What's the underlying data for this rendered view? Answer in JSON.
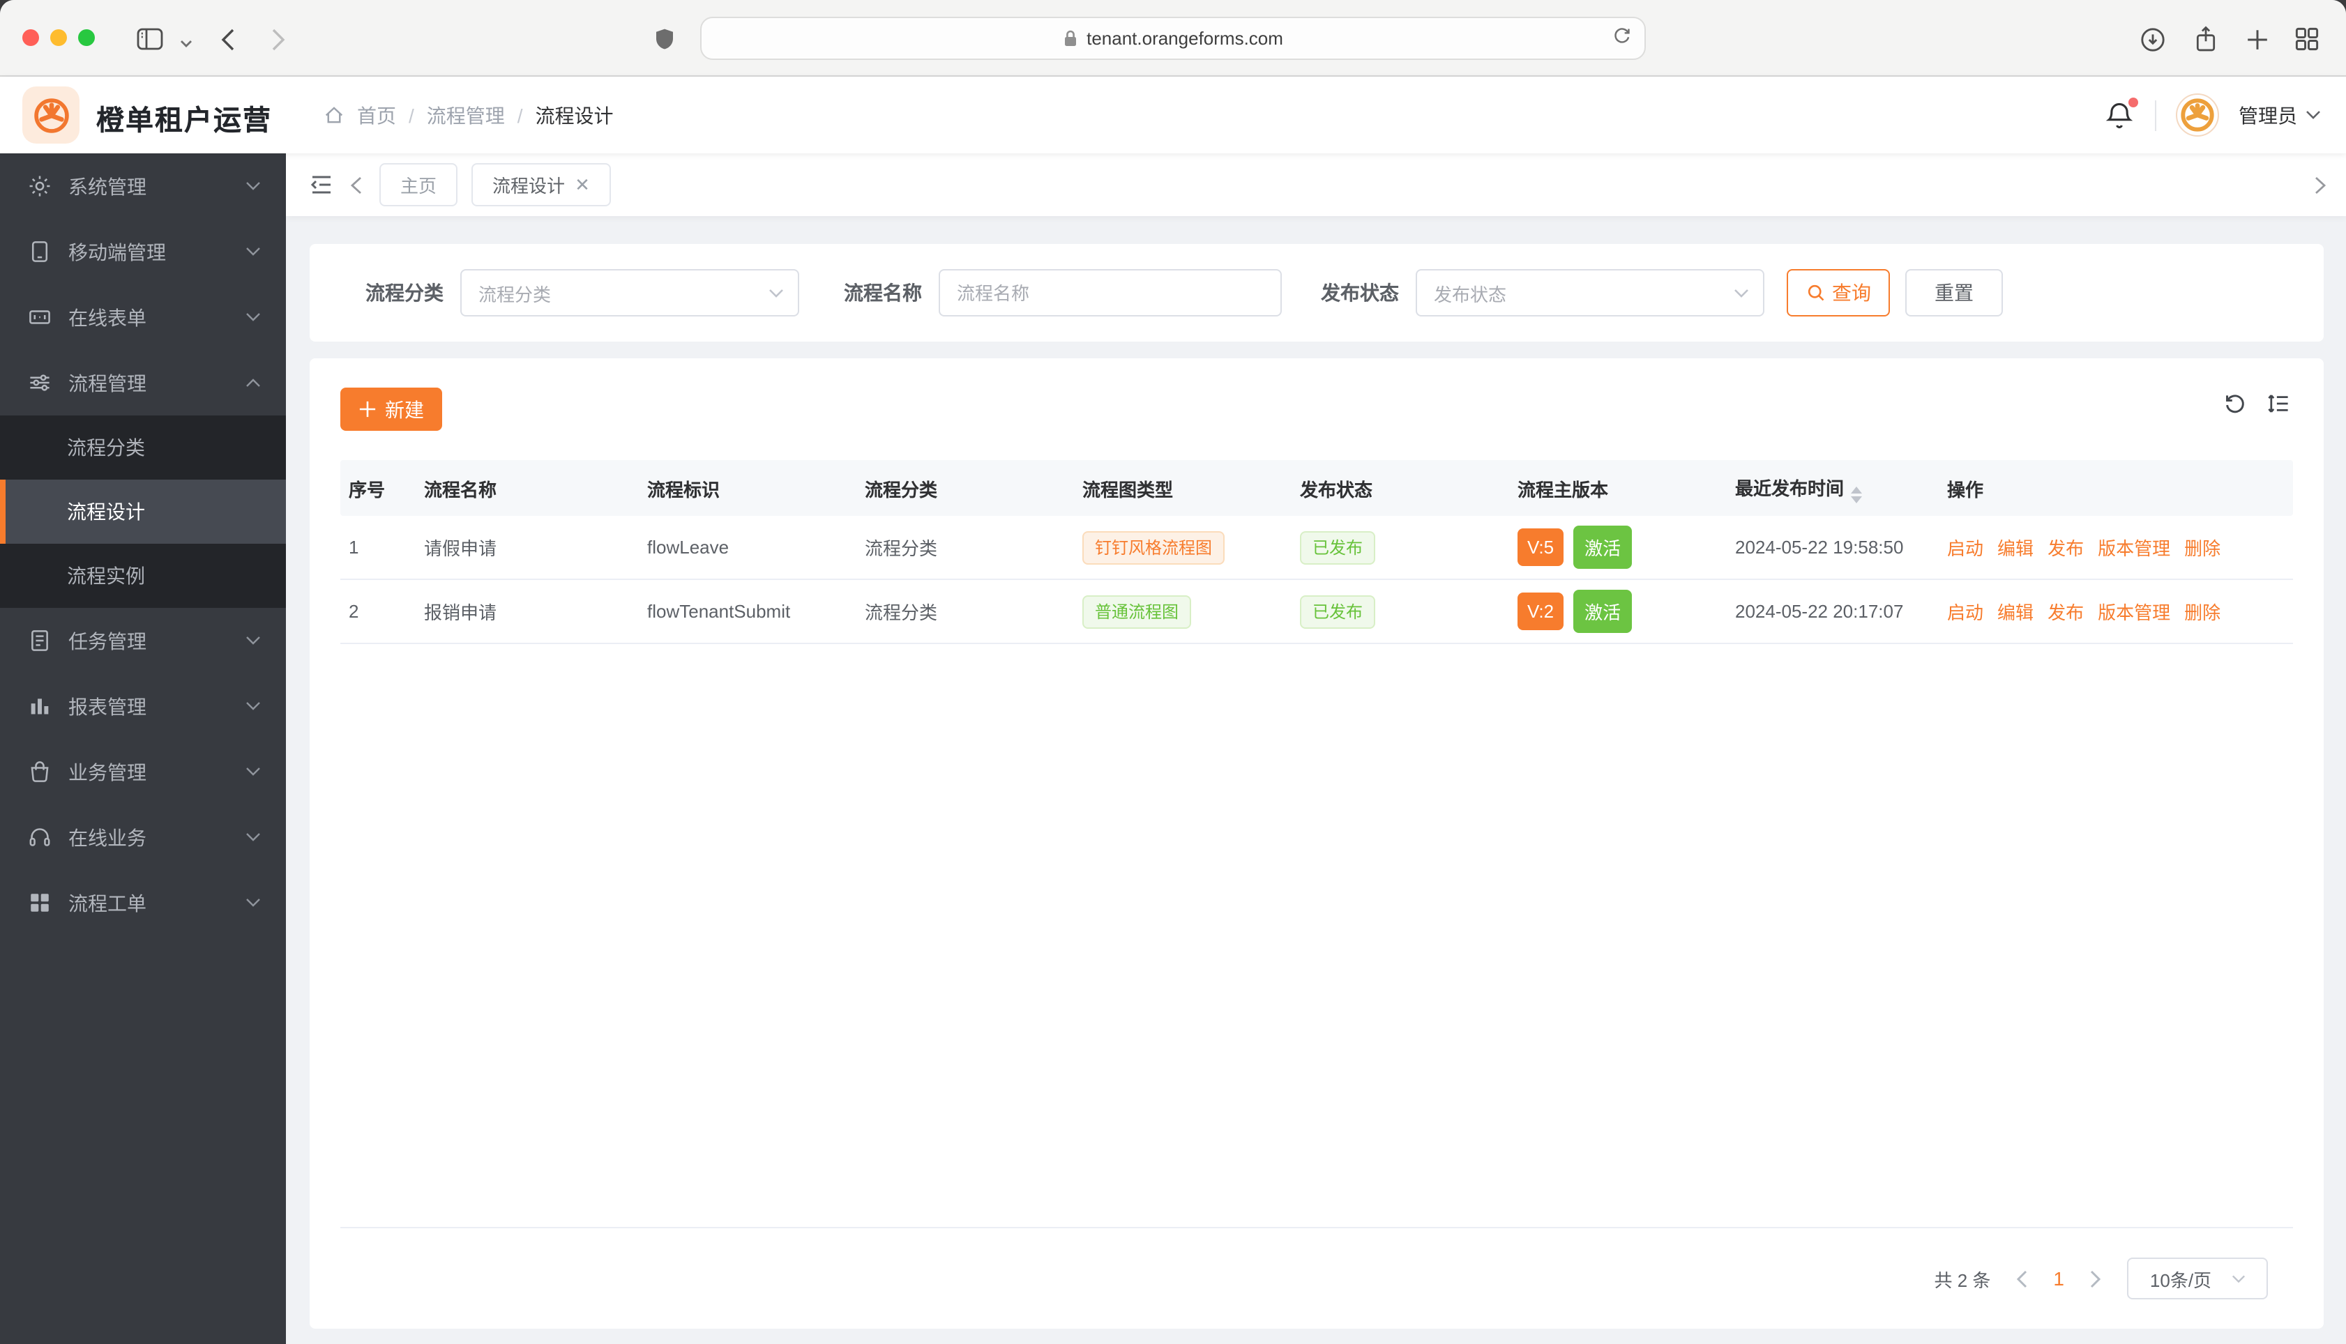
{
  "browser": {
    "url": "tenant.orangeforms.com"
  },
  "header": {
    "app_title": "橙单租户运营",
    "breadcrumb": [
      "首页",
      "流程管理",
      "流程设计"
    ],
    "user_name": "管理员"
  },
  "sidebar": {
    "items": [
      {
        "label": "系统管理"
      },
      {
        "label": "移动端管理"
      },
      {
        "label": "在线表单"
      },
      {
        "label": "流程管理"
      },
      {
        "label": "任务管理"
      },
      {
        "label": "报表管理"
      },
      {
        "label": "业务管理"
      },
      {
        "label": "在线业务"
      },
      {
        "label": "流程工单"
      }
    ],
    "submenu": [
      "流程分类",
      "流程设计",
      "流程实例"
    ]
  },
  "tabs": {
    "items": [
      {
        "label": "主页"
      },
      {
        "label": "流程设计"
      }
    ]
  },
  "filters": {
    "category_label": "流程分类",
    "category_placeholder": "流程分类",
    "name_label": "流程名称",
    "name_placeholder": "流程名称",
    "status_label": "发布状态",
    "status_placeholder": "发布状态",
    "query_label": "查询",
    "reset_label": "重置"
  },
  "toolbar": {
    "create_label": "新建"
  },
  "table": {
    "columns": [
      "序号",
      "流程名称",
      "流程标识",
      "流程分类",
      "流程图类型",
      "发布状态",
      "流程主版本",
      "最近发布时间",
      "操作"
    ],
    "action_labels": [
      "启动",
      "编辑",
      "发布",
      "版本管理",
      "删除"
    ],
    "rows": [
      {
        "index": "1",
        "name": "请假申请",
        "key": "flowLeave",
        "category": "流程分类",
        "diagram_type": "钉钉风格流程图",
        "publish_status": "已发布",
        "version": "V:5",
        "active": "激活",
        "published_at": "2024-05-22 19:58:50"
      },
      {
        "index": "2",
        "name": "报销申请",
        "key": "flowTenantSubmit",
        "category": "流程分类",
        "diagram_type": "普通流程图",
        "publish_status": "已发布",
        "version": "V:2",
        "active": "激活",
        "published_at": "2024-05-22 20:17:07"
      }
    ]
  },
  "pagination": {
    "total_text": "共 2 条",
    "current_page": "1",
    "page_size": "10条/页"
  },
  "colors": {
    "primary": "#f77c2d",
    "success": "#67c23a",
    "sidebar_bg": "#373a40",
    "notification_dot": "#f56c6c"
  }
}
